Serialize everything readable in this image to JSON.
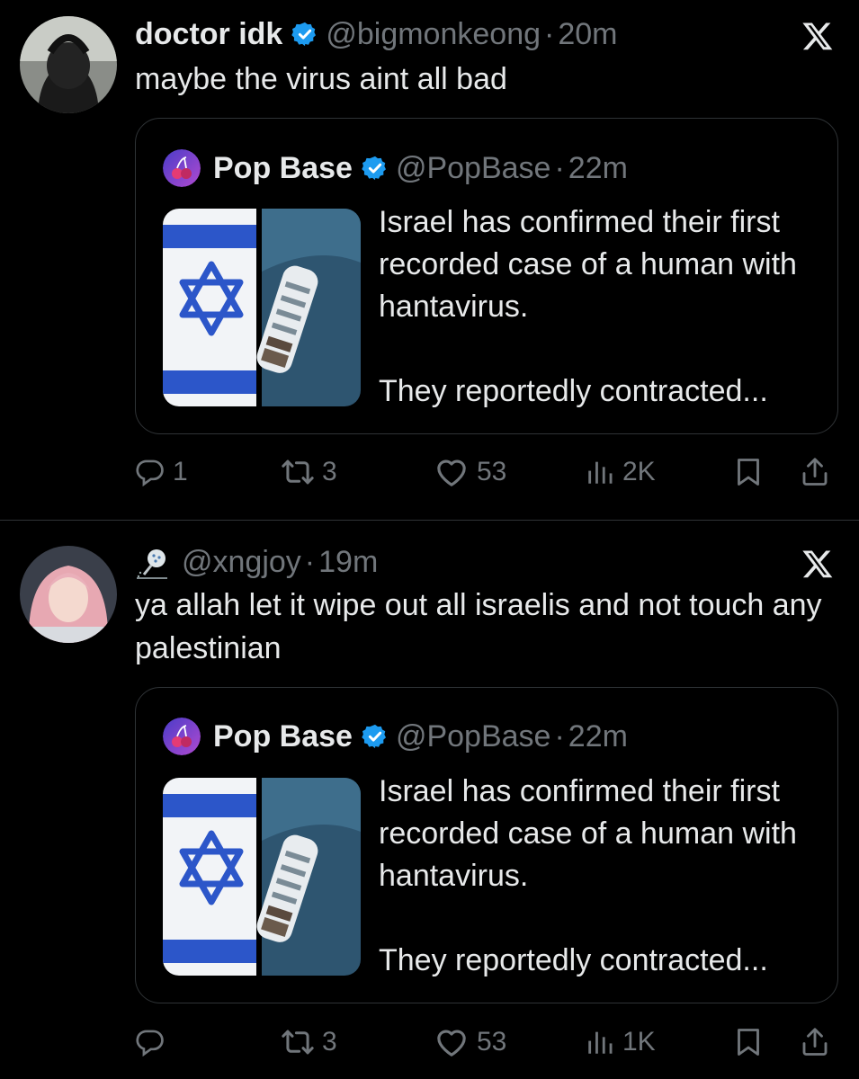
{
  "tweets": [
    {
      "name": "doctor idk",
      "handle": "@bigmonkeong",
      "time": "20m",
      "text": "maybe the virus aint all bad",
      "quote": {
        "name": "Pop Base",
        "handle": "@PopBase",
        "time": "22m",
        "text": "Israel has confirmed their first recorded case of a human with hantavirus.\n\nThey reportedly contracted..."
      },
      "actions": {
        "replies": "1",
        "retweets": "3",
        "likes": "53",
        "views": "2K"
      }
    },
    {
      "name": "",
      "handle": "@xngjoy",
      "time": "19m",
      "text": "ya allah let it wipe out all israelis and not touch any palestinian",
      "quote": {
        "name": "Pop Base",
        "handle": "@PopBase",
        "time": "22m",
        "text": "Israel has confirmed their first recorded case of a human with hantavirus.\n\nThey reportedly contracted..."
      },
      "actions": {
        "replies": "",
        "retweets": "3",
        "likes": "53",
        "views": "1K"
      }
    }
  ],
  "icons": {
    "verified": "verified-badge-icon",
    "x_logo": "x-logo-icon",
    "reply": "reply-icon",
    "retweet": "retweet-icon",
    "like": "heart-icon",
    "views": "views-icon",
    "bookmark": "bookmark-icon",
    "share": "share-icon"
  },
  "colors": {
    "background": "#000000",
    "text": "#e7e9ea",
    "secondary": "#71767b",
    "verified": "#1d9bf0",
    "border": "#2f3336"
  }
}
